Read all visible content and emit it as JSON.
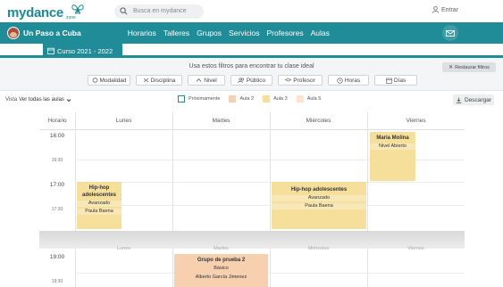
{
  "topbar": {
    "logo": "mydance",
    "logo_sub": "zone",
    "search_placeholder": "Busca en mydance",
    "login_label": "Entrar"
  },
  "navbar": {
    "brand": "Un Paso a Cuba",
    "links": [
      "Horarios",
      "Talleres",
      "Grupos",
      "Servicios",
      "Profesores",
      "Aulas"
    ]
  },
  "course_tab": "Curso 2021 - 2022",
  "filters": {
    "hint": "Usa estos filtros para encontrar tu clase ideal",
    "reset": "Restaurar filtros",
    "buttons": [
      "Modalidad",
      "Disciplina",
      "Nivel",
      "Público",
      "Profesor",
      "Horas",
      "Días"
    ]
  },
  "view": {
    "label": "Vista",
    "selected": "Ver todas las aulas",
    "download": "Descargar"
  },
  "legend": [
    {
      "label": "Próximamente",
      "color": "#ffffff",
      "border": "#1f8c97"
    },
    {
      "label": "Aula 2",
      "color": "#f7d0b0",
      "border": "#f7d0b0"
    },
    {
      "label": "Aula 3",
      "color": "#f5df9a",
      "border": "#f5df9a"
    },
    {
      "label": "Aula 5",
      "color": "#fbe3d4",
      "border": "#fbe3d4"
    }
  ],
  "schedule": {
    "time_header": "Horario",
    "days": [
      "Lunes",
      "Martes",
      "Miércoles",
      "Viernes"
    ],
    "times": [
      "16:00",
      "16:30",
      "17:00",
      "17:30",
      "19:00",
      "19:30"
    ],
    "events": {
      "mon": {
        "title": "Hip-hop adolescentes",
        "level": "Avanzado",
        "teacher": "Paula Baena"
      },
      "wed": {
        "title": "Hip-hop adolescentes",
        "level": "Avanzado",
        "teacher": "Paula Baena"
      },
      "fri": {
        "title": "Maria Molina",
        "level": "Nivel Abierto"
      },
      "tue": {
        "title": "Grupo de prueba 2",
        "level": "Básico",
        "teacher": "Alberto García Jimenez"
      }
    }
  },
  "colors": {
    "primary": "#1f8c97",
    "event_yellow": "#f5df9a",
    "event_orange": "#f7d0b0"
  }
}
